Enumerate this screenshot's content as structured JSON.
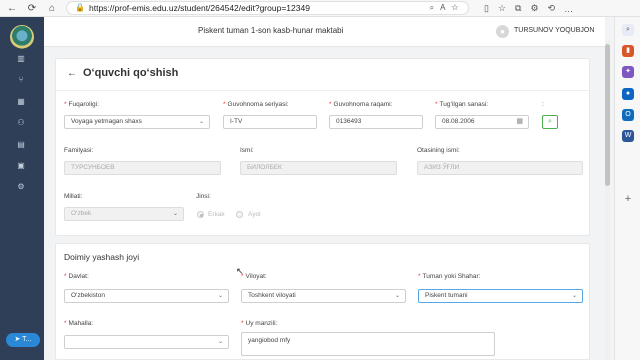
{
  "browser": {
    "url": "https://prof-emis.edu.uz/student/264542/edit?group=12349"
  },
  "header": {
    "school_name": "Piskent tuman 1-son kasb-hunar maktabi",
    "user_name": "TURSUNOV YOQUBJON"
  },
  "sidebar": {
    "icons": [
      "chart-icon",
      "branch-icon",
      "building-icon",
      "people-icon",
      "document-icon",
      "book-icon",
      "settings-icon"
    ],
    "chat_label": "T..."
  },
  "page": {
    "title": "O‘quvchi qo‘shish"
  },
  "form": {
    "citizenship": {
      "label": "Fuqaroligi:",
      "value": "Voyaga yetmagan shaxs"
    },
    "cert_series": {
      "label": "Guvohnoma seriyasi:",
      "value": "I-TV"
    },
    "cert_number": {
      "label": "Guvohnoma raqami:",
      "value": "0136493"
    },
    "birth_date": {
      "label": "Tug‘ilgan sanasi:",
      "value": "08.08.2006"
    },
    "extra_label": ":",
    "surname": {
      "label": "Familyasi:",
      "value": "ТУРСУНБОЕВ"
    },
    "name": {
      "label": "Ismi:",
      "value": "БИЛОЛБЕК"
    },
    "patronymic": {
      "label": "Otasining ismi:",
      "value": "АЗИЗ ЎҒЛИ"
    },
    "nationality": {
      "label": "Millati:",
      "value": "O‘zbek"
    },
    "gender": {
      "label": "Jinsi:",
      "male": "Erkak",
      "female": "Ayol"
    }
  },
  "residence": {
    "section_title": "Doimiy yashash joyi",
    "country": {
      "label": "Davlat:",
      "value": "O‘zbekiston"
    },
    "region": {
      "label": "Viloyat:",
      "value": "Toshkent viloyati"
    },
    "district": {
      "label": "Tuman yoki Shahar:",
      "value": "Piskent tumani"
    },
    "mahalla": {
      "label": "Mahalla:",
      "value": ""
    },
    "address": {
      "label": "Uy manzili:",
      "value": "yangiobod mfy"
    }
  }
}
